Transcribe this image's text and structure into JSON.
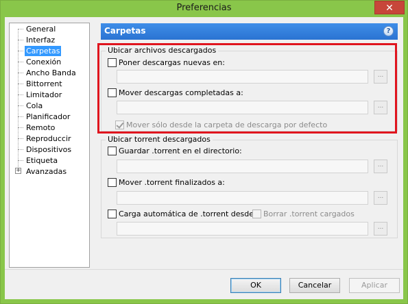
{
  "window": {
    "title": "Preferencias",
    "close_label": "✕"
  },
  "tree": {
    "items": [
      {
        "label": "General",
        "selected": false
      },
      {
        "label": "Interfaz",
        "selected": false
      },
      {
        "label": "Carpetas",
        "selected": true
      },
      {
        "label": "Conexión",
        "selected": false
      },
      {
        "label": "Ancho Banda",
        "selected": false
      },
      {
        "label": "Bittorrent",
        "selected": false
      },
      {
        "label": "Limitador",
        "selected": false
      },
      {
        "label": "Cola",
        "selected": false
      },
      {
        "label": "Planificador",
        "selected": false
      },
      {
        "label": "Remoto",
        "selected": false
      },
      {
        "label": "Reproduccir",
        "selected": false
      },
      {
        "label": "Dispositivos",
        "selected": false
      },
      {
        "label": "Etiqueta",
        "selected": false
      },
      {
        "label": "Avanzadas",
        "selected": false,
        "expandable": true
      }
    ],
    "expander_symbol": "+"
  },
  "panel": {
    "title": "Carpetas",
    "help_icon": "?"
  },
  "group_downloads": {
    "title": "Ubicar archivos descargados",
    "new_downloads_label": "Poner descargas nuevas en:",
    "new_downloads_value": "",
    "move_completed_label": "Mover descargas completadas a:",
    "move_completed_value": "",
    "only_default_label": "Mover sólo desde la carpeta de descarga por defecto",
    "browse_label": "..."
  },
  "group_torrents": {
    "title": "Ubicar torrent descargados",
    "store_torrent_label": "Guardar .torrent en el directorio:",
    "store_torrent_value": "",
    "move_finished_label": "Mover .torrent finalizados a:",
    "move_finished_value": "",
    "autoload_label": "Carga automática de .torrent desde:",
    "autoload_value": "",
    "delete_loaded_label": "Borrar .torrent cargados",
    "browse_label": "..."
  },
  "buttons": {
    "ok": "OK",
    "cancel": "Cancelar",
    "apply": "Aplicar"
  },
  "colors": {
    "accent": "#89c64a",
    "header": "#2a73d2",
    "selected": "#3399ff",
    "highlight": "#e0141e"
  }
}
